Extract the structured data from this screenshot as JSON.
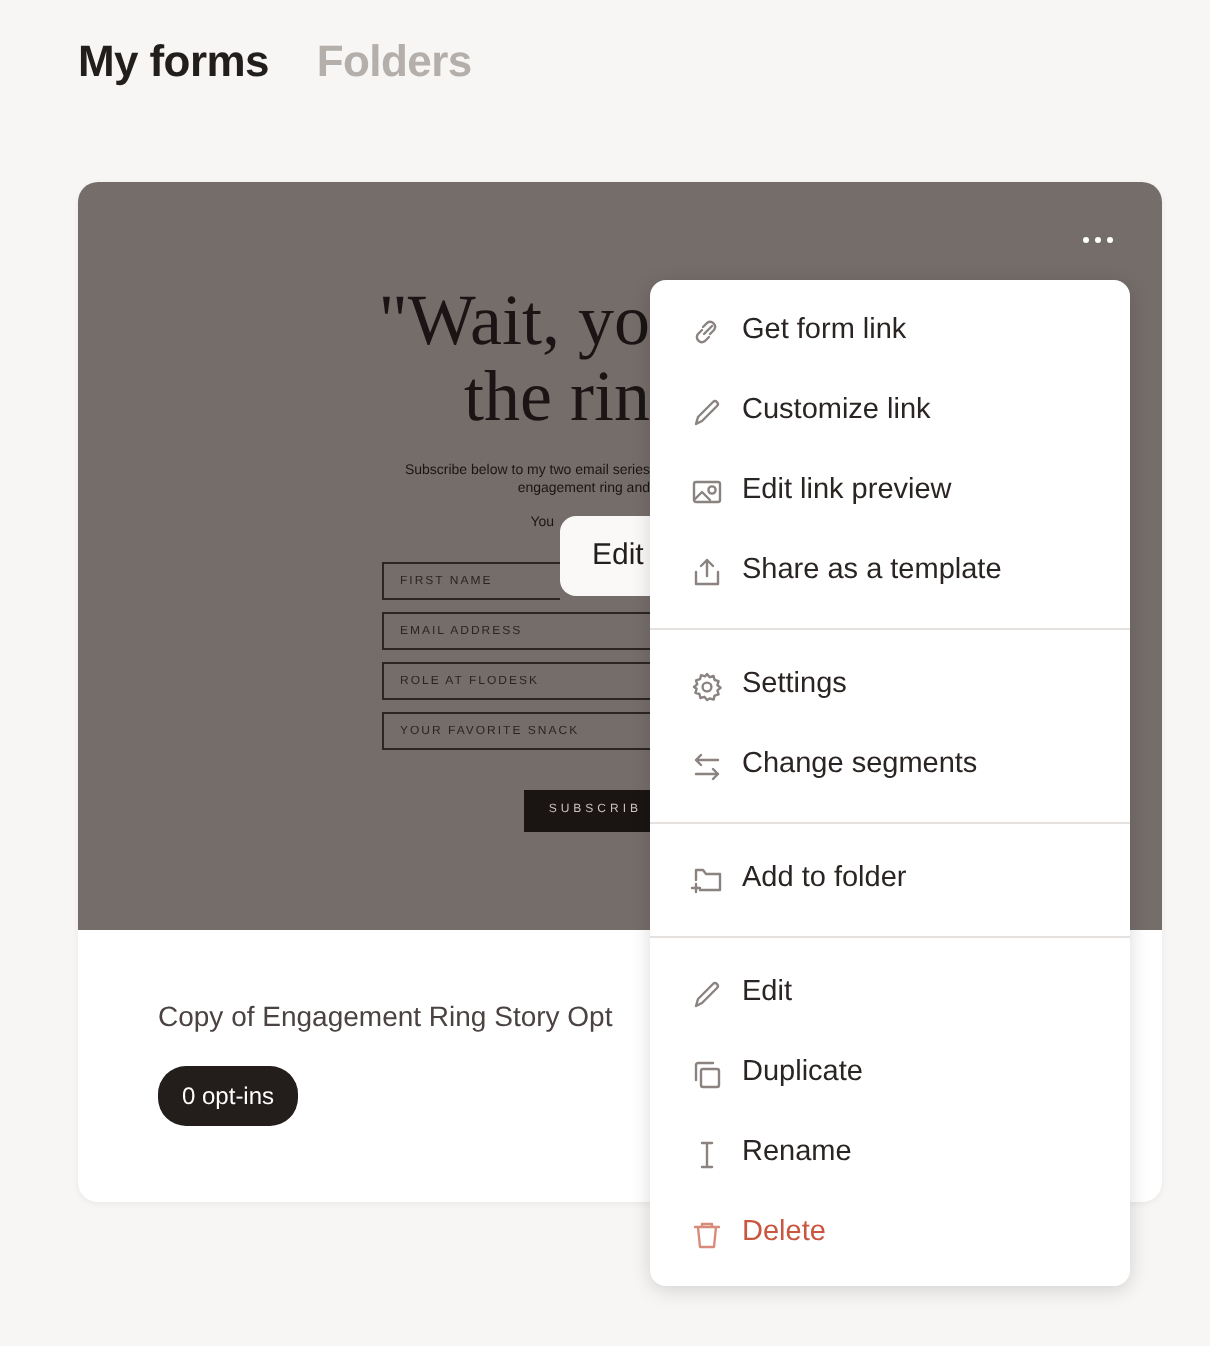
{
  "tabs": [
    {
      "label": "My forms",
      "selected": true
    },
    {
      "label": "Folders",
      "selected": false
    }
  ],
  "form_card": {
    "preview": {
      "headline": [
        "\"Wait, yo",
        "the rin"
      ],
      "intro": [
        "Subscribe below to my two email series",
        "engagement ring and"
      ],
      "note": "You",
      "fields": [
        {
          "placeholder": "FIRST NAME"
        },
        {
          "placeholder": "EMAIL ADDRESS"
        },
        {
          "placeholder": "ROLE AT FLODESK"
        },
        {
          "placeholder": "YOUR FAVORITE SNACK"
        }
      ],
      "submit": "SUBSCRIB",
      "edit_button": "Edit"
    },
    "title": "Copy of Engagement Ring Story Opt",
    "badge": "0 opt-ins"
  },
  "menu": {
    "groups": [
      [
        {
          "label": "Get form link",
          "kind": "default"
        },
        {
          "label": "Customize link",
          "kind": "default"
        },
        {
          "label": "Edit link preview",
          "kind": "default"
        },
        {
          "label": "Share as a template",
          "kind": "default"
        }
      ],
      [
        {
          "label": "Settings",
          "kind": "default"
        },
        {
          "label": "Change segments",
          "kind": "default"
        }
      ],
      [
        {
          "label": "Add to folder",
          "kind": "default"
        }
      ],
      [
        {
          "label": "Edit",
          "kind": "default"
        },
        {
          "label": "Duplicate",
          "kind": "default"
        },
        {
          "label": "Rename",
          "kind": "default"
        },
        {
          "label": "Delete",
          "kind": "danger"
        }
      ]
    ]
  }
}
